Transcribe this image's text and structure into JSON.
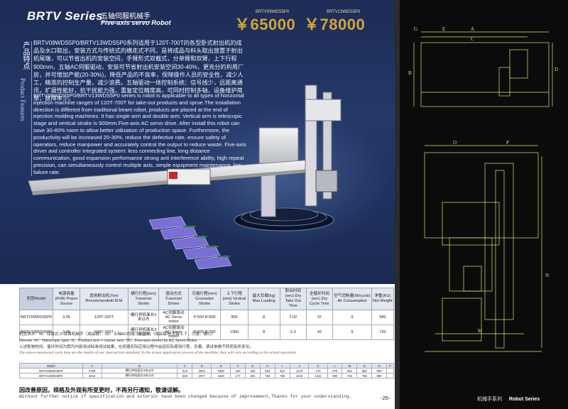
{
  "header": {
    "series": "BRTV Series",
    "subtitle_cn": "五轴伺服机械手",
    "subtitle_en": "Five-axis servo Robot",
    "prices": [
      {
        "model": "BRTV09WDS5P0",
        "price": "￥65000"
      },
      {
        "model": "BRTV13WDS5P0",
        "price": "￥78000"
      }
    ]
  },
  "features": {
    "label_cn": "产品特点",
    "label_en": "Product Features",
    "text_cn": "BRTV09WDS5P0/BRTV13WDS5P0系列适用于120T-700T的各型卧式射出机的成品及水口取出，安装方式与传统式的横走式不同，是将成品与料头取出放置于射出机尾端，可以节省出机的安装空间，手臂形式双截式，分单臂和双臂，上下行程900mm，五轴AC伺服驱动，安装可节省射出机安装空间30-40%，更充分的利用厂房，并可增加产能(20-30%)，降低产品的不良率，保障操作人员的安全性，减少人工，精准的控制生产量，减少浪费。五轴驱动一体控制系统：信号线少，远距离通讯，扩展性能好，抗干扰能力强，重复定位精度高，可同时控制多轴，设备维护简单，故障率少。",
    "text_en": "BRTV09WDS5P0/BRTV13WDS5P0 series is robot is applicable to all types of horizontal injection machine ranges of 120T-700T for take-out products and sprue.The installation direction is different from traditional beam robot, products are placed at the end of injection molding machines. It has single arm and double arm. Vertical arm is telescopic stage and vertical stroke is 900mm.Five-axis AC servo drive. After install this robot can save 30-40% room to allow better utilization of production space. Furthermore, the productivity will be increased 20-30%, reduce the defective rate, ensure safety of operators, reduce manpower and accurately control the output to reduce waste. Five-axis driver and controller integrated system: less connecting line, long distance communication, good expansion performance strong anti interference ability, high repeat precision, can simultaneously control multiple axis, simple equipment maintenance, low failure rate."
  },
  "spec_table": {
    "headers": [
      "机型Model",
      "电源容量(KVA) Power Source",
      "适用射出机(Ton) RecommendedI.M.M",
      "横行行程(mm) Traverser Stroke",
      "驱动方式Traverser Driven",
      "引拔行程(mm) Crosswise Stroke",
      "上下行程(mm) Vertical Stroke",
      "最大负载(kg) Max.Loading",
      "取出时间(sec) Dry Take Out Time",
      "全循环时间(sec) Dry Cycle Time",
      "空气消耗量(NI/cycle) Air Consumption",
      "净重(KG) Net Weight"
    ],
    "rows": [
      [
        "BRTV09WDS5P0",
        "3.05",
        "120T-320T",
        "横行挤机面长3米以内",
        "AC伺服驱动 AC Servo motor",
        "P:550 R:506",
        "900",
        "8",
        "2.02",
        "37",
        "9",
        "580"
      ],
      [
        "BRTV13WDS5P0",
        "3.05",
        "220T-700T",
        "横行挤机面长3米以内",
        "AC伺服驱动 AC Servo motor",
        "P:825 R:755",
        "1300",
        "8",
        "2.3",
        "42",
        "9",
        "720"
      ]
    ]
  },
  "notes": {
    "line1": "机型表示：W：双臂式 D:双臂机械手（成品臂） S5：五轴AC伺服马达驱动（成品臂/料头臂上下、引拔、横行）",
    "line2": "Denote: W：Telescopic type. D：Product arm + runner arm. S5：Five-axis driven by AC Servo Motor.",
    "line3": "上述取物时间，循环时间为我司内部测试标准测试结果，在机器实际应用过程中会因实际使用行程、负载、调试参数不同而有所变化。",
    "line4": "The above-mentioned cycle time are the results of our internal test standard. In the actual application process of the machine, they will vary according to the actual operation"
  },
  "dim_table": {
    "rows": [
      [
        "Model",
        "A",
        "B",
        "C",
        "D",
        "E",
        "F",
        "G",
        "H",
        "I",
        "J",
        "K",
        "L",
        "M",
        "N",
        "O",
        "P"
      ],
      [
        "BRTV09WDS5P0",
        "1768",
        "横行挤机面长3米以内",
        "318",
        "2054",
        "1680",
        "163",
        "286",
        "553",
        "510",
        "1276",
        "170",
        "378",
        "546",
        "585",
        "860",
        ""
      ],
      [
        "BRTV13WDS5P0",
        "2018",
        "横行挤机面长3米以内",
        "329",
        "2077",
        "1820",
        "177",
        "281",
        "756",
        "765",
        "1418",
        "1311",
        "390",
        "726",
        "736",
        "880",
        ""
      ]
    ]
  },
  "footer": {
    "cn": "因改善原因，规格及外观有所变更时，不再另行通知，敬请谅解。",
    "en": "Without further notice if specification and exterior have been changed because of improvement,Thanks for your understanding.",
    "page_number": "-25-",
    "right_cn": "机械手系列",
    "right_en": "Robot Series"
  },
  "drawing": {
    "labels": [
      "G",
      "E",
      "A",
      "B",
      "D",
      "C",
      "O",
      "P",
      "M",
      "N"
    ]
  }
}
